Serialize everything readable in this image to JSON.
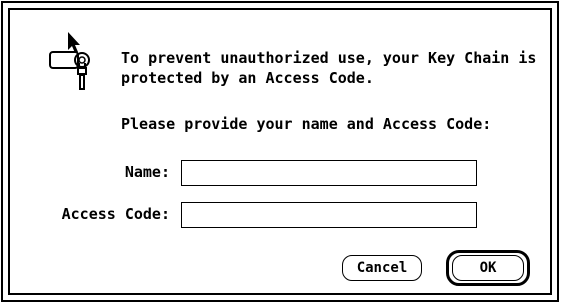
{
  "dialog": {
    "message": "To prevent unauthorized use, your Key Chain is protected by an Access Code.",
    "prompt": "Please provide your name and Access Code:",
    "icon": "keychain-lock-icon"
  },
  "form": {
    "name_label": "Name:",
    "name_value": "",
    "access_code_label": "Access Code:",
    "access_code_value": ""
  },
  "buttons": {
    "cancel_label": "Cancel",
    "ok_label": "OK"
  }
}
